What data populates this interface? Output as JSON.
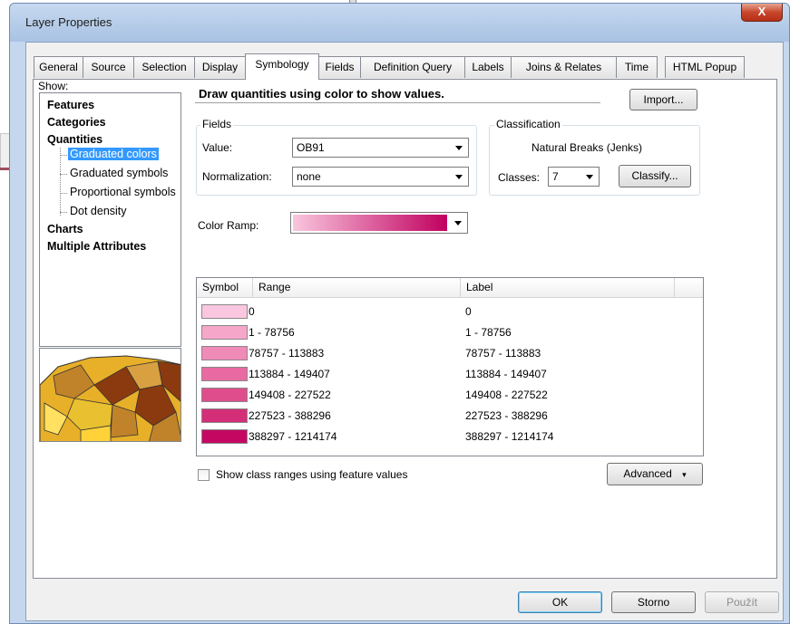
{
  "window": {
    "title": "Layer Properties",
    "close_glyph": "X"
  },
  "tabs": [
    "General",
    "Source",
    "Selection",
    "Display",
    "Symbology",
    "Fields",
    "Definition Query",
    "Labels",
    "Joins & Relates",
    "Time",
    "HTML Popup"
  ],
  "active_tab": "Symbology",
  "show": {
    "label": "Show:",
    "items": {
      "features": "Features",
      "categories": "Categories",
      "quantities": "Quantities",
      "graduated_colors": "Graduated colors",
      "graduated_symbols": "Graduated symbols",
      "proportional_symbols": "Proportional symbols",
      "dot_density": "Dot density",
      "charts": "Charts",
      "multiple_attributes": "Multiple Attributes"
    }
  },
  "description": "Draw quantities using color to show values.",
  "import_label": "Import...",
  "fields": {
    "group_label": "Fields",
    "value_label": "Value:",
    "value": "OB91",
    "normalization_label": "Normalization:",
    "normalization": "none"
  },
  "classification": {
    "group_label": "Classification",
    "method": "Natural Breaks (Jenks)",
    "classes_label": "Classes:",
    "classes": "7",
    "classify_label": "Classify..."
  },
  "color_ramp": {
    "label": "Color Ramp:",
    "start": "#f9c6de",
    "end": "#c10060"
  },
  "table": {
    "headers": {
      "symbol": "Symbol",
      "range": "Range",
      "label": "Label"
    },
    "rows": [
      {
        "color": "#fbc6df",
        "range": "0",
        "label": "0"
      },
      {
        "color": "#f6a6c9",
        "range": "1 - 78756",
        "label": "1 - 78756"
      },
      {
        "color": "#f08ab7",
        "range": "78757 - 113883",
        "label": "78757 - 113883"
      },
      {
        "color": "#e96aa2",
        "range": "113884 - 149407",
        "label": "113884 - 149407"
      },
      {
        "color": "#df4d8d",
        "range": "149408 - 227522",
        "label": "149408 - 227522"
      },
      {
        "color": "#d42e78",
        "range": "227523 - 388296",
        "label": "227523 - 388296"
      },
      {
        "color": "#c40862",
        "range": "388297 - 1214174",
        "label": "388297 - 1214174"
      }
    ]
  },
  "show_ranges_label": "Show class ranges using feature values",
  "advanced_label": "Advanced",
  "buttons": {
    "ok": "OK",
    "cancel": "Storno",
    "apply": "Použít"
  }
}
